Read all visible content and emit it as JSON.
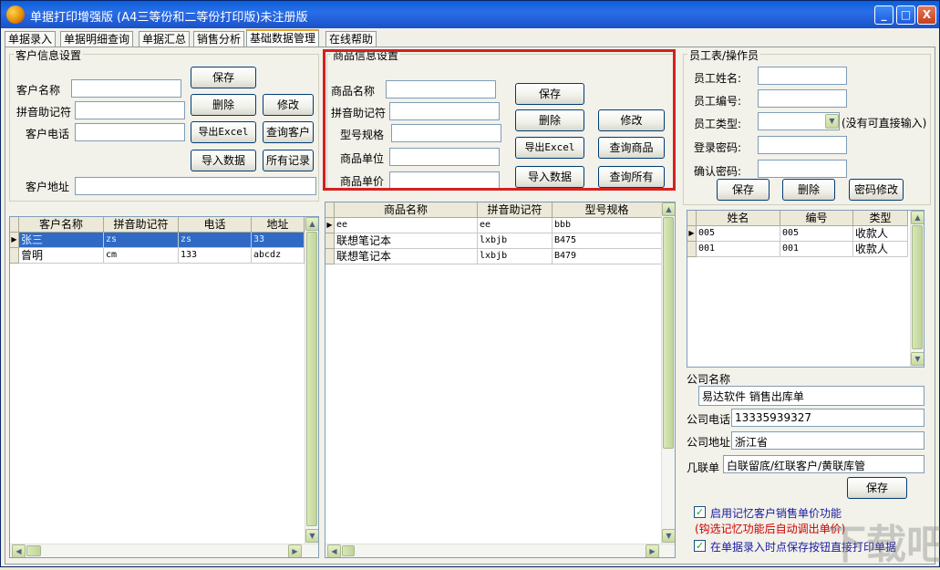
{
  "window": {
    "title": "单据打印增强版 (A4三等份和二等份打印版)未注册版",
    "min_label": "_",
    "max_label": "□",
    "close_label": "X"
  },
  "tabs": [
    "单据录入",
    "单据明细查询",
    "单据汇总",
    "销售分析",
    "基础数据管理",
    "在线帮助"
  ],
  "active_tab": "基础数据管理",
  "customer": {
    "group_title": "客户信息设置",
    "name_label": "客户名称",
    "pinyin_label": "拼音助记符",
    "phone_label": "客户电话",
    "address_label": "客户地址",
    "buttons": {
      "save": "保存",
      "delete": "删除",
      "edit": "修改",
      "export": "导出Excel",
      "query": "查询客户",
      "import": "导入数据",
      "all": "所有记录"
    },
    "columns": [
      "客户名称",
      "拼音助记符",
      "电话",
      "地址"
    ],
    "rows": [
      {
        "name": "张三",
        "pinyin": "zs",
        "phone": "zs",
        "address": "33"
      },
      {
        "name": "曾明",
        "pinyin": "cm",
        "phone": "133",
        "address": "abcdz"
      }
    ]
  },
  "product": {
    "group_title": "商品信息设置",
    "name_label": "商品名称",
    "pinyin_label": "拼音助记符",
    "model_label": "型号规格",
    "unit_label": "商品单位",
    "price_label": "商品单价",
    "buttons": {
      "save": "保存",
      "delete": "删除",
      "edit": "修改",
      "export": "导出Excel",
      "query": "查询商品",
      "import": "导入数据",
      "all": "查询所有"
    },
    "columns": [
      "商品名称",
      "拼音助记符",
      "型号规格"
    ],
    "rows": [
      {
        "name": "ee",
        "pinyin": "ee",
        "model": "bbb"
      },
      {
        "name": "联想笔记本",
        "pinyin": "lxbjb",
        "model": "B475"
      },
      {
        "name": "联想笔记本",
        "pinyin": "lxbjb",
        "model": "B479"
      }
    ]
  },
  "employee": {
    "group_title": "员工表/操作员",
    "name_label": "员工姓名:",
    "id_label": "员工编号:",
    "type_label": "员工类型:",
    "type_hint": "(没有可直接输入)",
    "password_label": "登录密码:",
    "confirm_label": "确认密码:",
    "buttons": {
      "save": "保存",
      "delete": "删除",
      "change_pw": "密码修改"
    },
    "columns": [
      "姓名",
      "编号",
      "类型"
    ],
    "rows": [
      {
        "name": "005",
        "id": "005",
        "type": "收款人"
      },
      {
        "name": "001",
        "id": "001",
        "type": "收款人"
      }
    ]
  },
  "company": {
    "name_label": "公司名称",
    "name_value": "易达软件 销售出库单",
    "phone_label": "公司电话",
    "phone_value": "13335939327",
    "address_label": "公司地址",
    "address_value": "浙江省",
    "copies_label": "几联单",
    "copies_value": "白联留底/红联客户/黄联库管",
    "save_label": "保存",
    "opt1_label": "启用记忆客户销售单价功能",
    "opt1_note": "(钩选记忆功能后自动调出单价)",
    "opt2_label": "在单据录入时点保存按钮直接打印单据",
    "check_mark": "✓"
  },
  "watermark": "下载吧",
  "colors": {
    "titlebar": "#0a5fd8",
    "selected_row": "#316ac5",
    "highlight": "#d42020",
    "note_red": "#cc0000",
    "opt_blue": "#1a1aa0"
  }
}
